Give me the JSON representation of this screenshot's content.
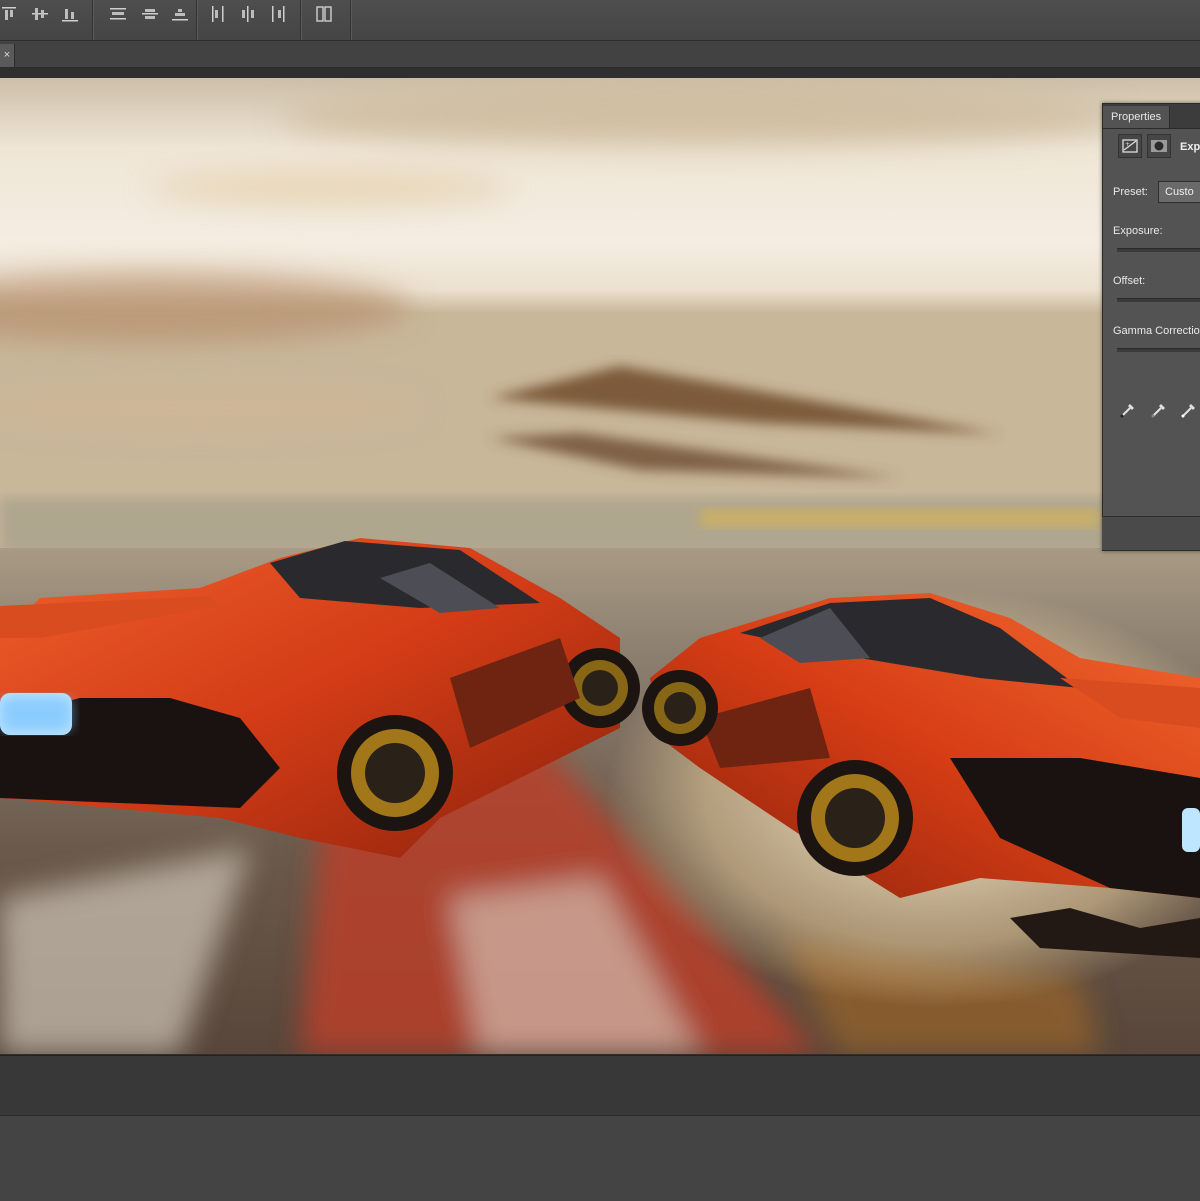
{
  "topbar": {
    "align_icons": [
      "align-top-edges-icon",
      "align-vertical-centers-icon",
      "align-bottom-edges-icon"
    ],
    "distribute_icons": [
      "distribute-top-icon",
      "distribute-center-icon",
      "distribute-bottom-icon"
    ],
    "distribute_h_icons": [
      "distribute-left-icon",
      "distribute-h-center-icon",
      "distribute-right-icon"
    ],
    "arrange_icon": "auto-align-layers-icon"
  },
  "document_tab": {
    "close_label": "×"
  },
  "properties_panel": {
    "tab_label": "Properties",
    "adjustment_title": "Expo",
    "preset_label": "Preset:",
    "preset_value": "Custo",
    "exposure_label": "Exposure:",
    "offset_label": "Offset:",
    "gamma_label": "Gamma Correctio",
    "eyedroppers": [
      "black-point-eyedropper-icon",
      "gray-point-eyedropper-icon",
      "white-point-eyedropper-icon"
    ]
  },
  "colors": {
    "ui_dark": "#3a3a3a",
    "panel": "#535353",
    "car_orange": "#e0451c"
  }
}
